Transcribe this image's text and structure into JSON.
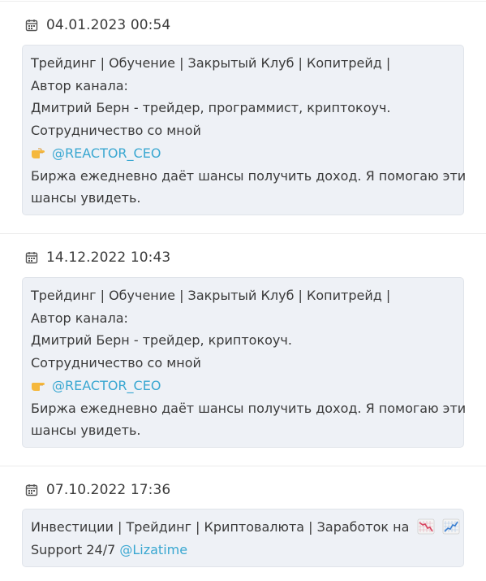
{
  "posts": [
    {
      "date": "04.01.2023 00:54",
      "lines": [
        "Трейдинг | Обучение | Закрытый Клуб | Копитрейд |",
        "Автор канала:",
        "Дмитрий Берн - трейдер, программист, криптокоуч.",
        "Сотрудничество со мной"
      ],
      "link": "@REACTOR_CEO",
      "link_icon": "pointing-hand-icon",
      "tail_lines": [
        "Биржа ежедневно даёт шансы получить доход. Я помогаю эти",
        "шансы увидеть."
      ]
    },
    {
      "date": "14.12.2022 10:43",
      "lines": [
        "Трейдинг | Обучение | Закрытый Клуб | Копитрейд |",
        "Автор канала:",
        "Дмитрий Берн - трейдер, криптокоуч.",
        "Сотрудничество со мной"
      ],
      "link": "@REACTOR_CEO",
      "link_icon": "pointing-hand-icon",
      "tail_lines": [
        "Биржа ежедневно даёт шансы получить доход. Я помогаю эти",
        "шансы увидеть."
      ]
    },
    {
      "date": "07.10.2022 17:36",
      "line1": "Инвестиции | Трейдинг | Криптовалюта | Заработок на",
      "line1_icons": [
        "chart-decreasing-icon",
        "chart-increasing-icon"
      ],
      "line2_prefix": "Support 24/7",
      "link": "@Lizatime"
    }
  ],
  "colors": {
    "card_bg": "#eef1f6",
    "link": "#39a7d1",
    "text": "#3a3a3a"
  }
}
